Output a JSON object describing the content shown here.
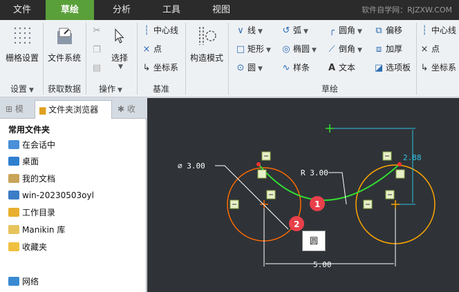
{
  "tabs": {
    "file": "文件",
    "sketch": "草绘",
    "analysis": "分析",
    "tools": "工具",
    "view": "视图",
    "watermark": "软件自学网：RJZXW.COM"
  },
  "ribbon": {
    "grid_settings": "栅格设置",
    "settings_group": "设置",
    "file_system": "文件系统",
    "get_data_group": "获取数据",
    "select": "选择",
    "operations_group": "操作",
    "datum": {
      "centerline": "中心线",
      "point": "点",
      "coord": "坐标系",
      "group": "基准"
    },
    "construction_mode": "构造模式",
    "sketch": {
      "line": "线",
      "rectangle": "矩形",
      "circle": "圆",
      "arc": "弧",
      "ellipse": "椭圆",
      "spline": "样条",
      "fillet": "圆角",
      "chamfer": "倒角",
      "text": "文本",
      "offset": "偏移",
      "thicken": "加厚",
      "palette": "选项板",
      "centerline": "中心线",
      "point": "点",
      "coord": "坐标系",
      "group": "草绘"
    }
  },
  "left_panel": {
    "tab_folder_browser": "文件夹浏览器",
    "section_title": "常用文件夹",
    "items": [
      {
        "label": "在会话中"
      },
      {
        "label": "桌面"
      },
      {
        "label": "我的文档"
      },
      {
        "label": "win-20230503oyl"
      },
      {
        "label": "工作目录"
      },
      {
        "label": "Manikin 库"
      },
      {
        "label": "收藏夹"
      },
      {
        "label": "网络"
      }
    ]
  },
  "canvas": {
    "dim_diameter": "⌀ 3.00",
    "dim_radius": "R 3.00",
    "dim_width": "5.00",
    "dim_height": "2.88",
    "callout_1": "1",
    "callout_2": "2",
    "tooltip": "圆",
    "colors": {
      "background": "#2f3337",
      "left_circle": "#ff6a00",
      "right_circle": "#ffa500",
      "arc": "#33dd33",
      "dimension": "#ffffff",
      "dimension_cyan": "#2ec3e6",
      "callout": "#e8404a"
    }
  }
}
